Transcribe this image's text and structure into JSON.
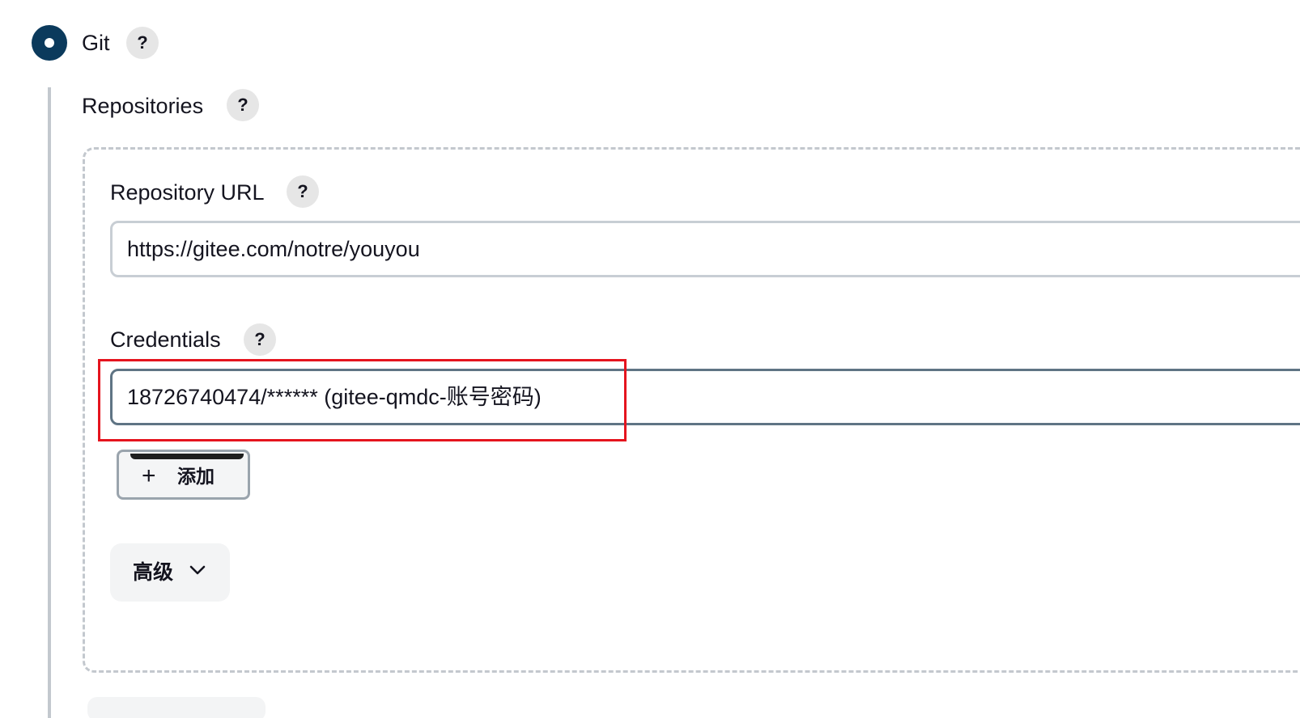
{
  "scm": {
    "option_label": "Git",
    "help_glyph": "?",
    "repositories_label": "Repositories"
  },
  "repository": {
    "url_label": "Repository URL",
    "url_value": "https://gitee.com/notre/youyou",
    "credentials_label": "Credentials",
    "credentials_value": "18726740474/****** (gitee-qmdc-账号密码)",
    "add_button_icon": "plus-icon",
    "add_button_label": "添加",
    "advanced_label": "高级",
    "advanced_icon": "chevron-down-icon"
  },
  "colors": {
    "radio_selected": "#0b3a5c",
    "highlight_annotation": "#e5141e"
  }
}
